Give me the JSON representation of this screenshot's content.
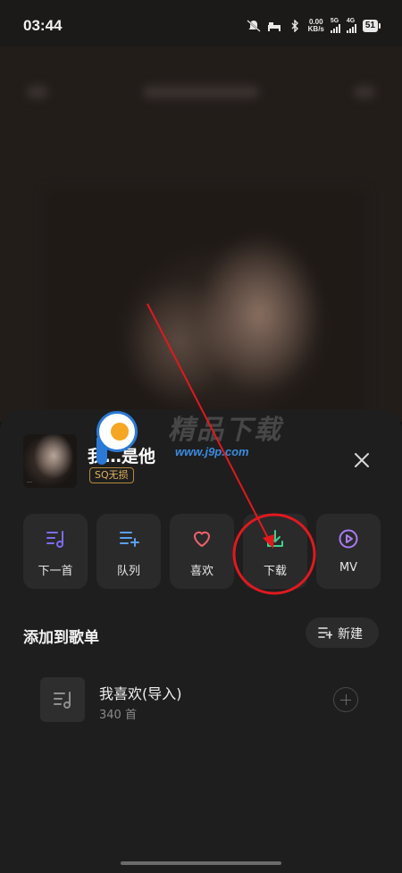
{
  "status_bar": {
    "time": "03:44",
    "speed_top": "0.00",
    "speed_unit": "KB/s",
    "net1": "5G",
    "net2": "4G",
    "battery": "51"
  },
  "song": {
    "title": "我…是他",
    "badge": "SQ无损",
    "cover_caption": "…"
  },
  "actions": [
    {
      "label": "下一首",
      "icon": "play-next-icon"
    },
    {
      "label": "队列",
      "icon": "queue-add-icon"
    },
    {
      "label": "喜欢",
      "icon": "heart-icon"
    },
    {
      "label": "下载",
      "icon": "download-icon"
    },
    {
      "label": "MV",
      "icon": "mv-play-icon"
    }
  ],
  "section": {
    "title": "添加到歌单",
    "new_label": "新建"
  },
  "playlist": {
    "name": "我喜欢(导入)",
    "count": "340 首"
  },
  "watermark": {
    "text": "精品下载",
    "url": "www.j9p.com"
  },
  "colors": {
    "accent_purple": "#7b6cf0",
    "accent_blue": "#5aa0f0",
    "heart_red": "#f0616d",
    "download_green": "#3fcf8e",
    "annotation_red": "#e0191f"
  }
}
